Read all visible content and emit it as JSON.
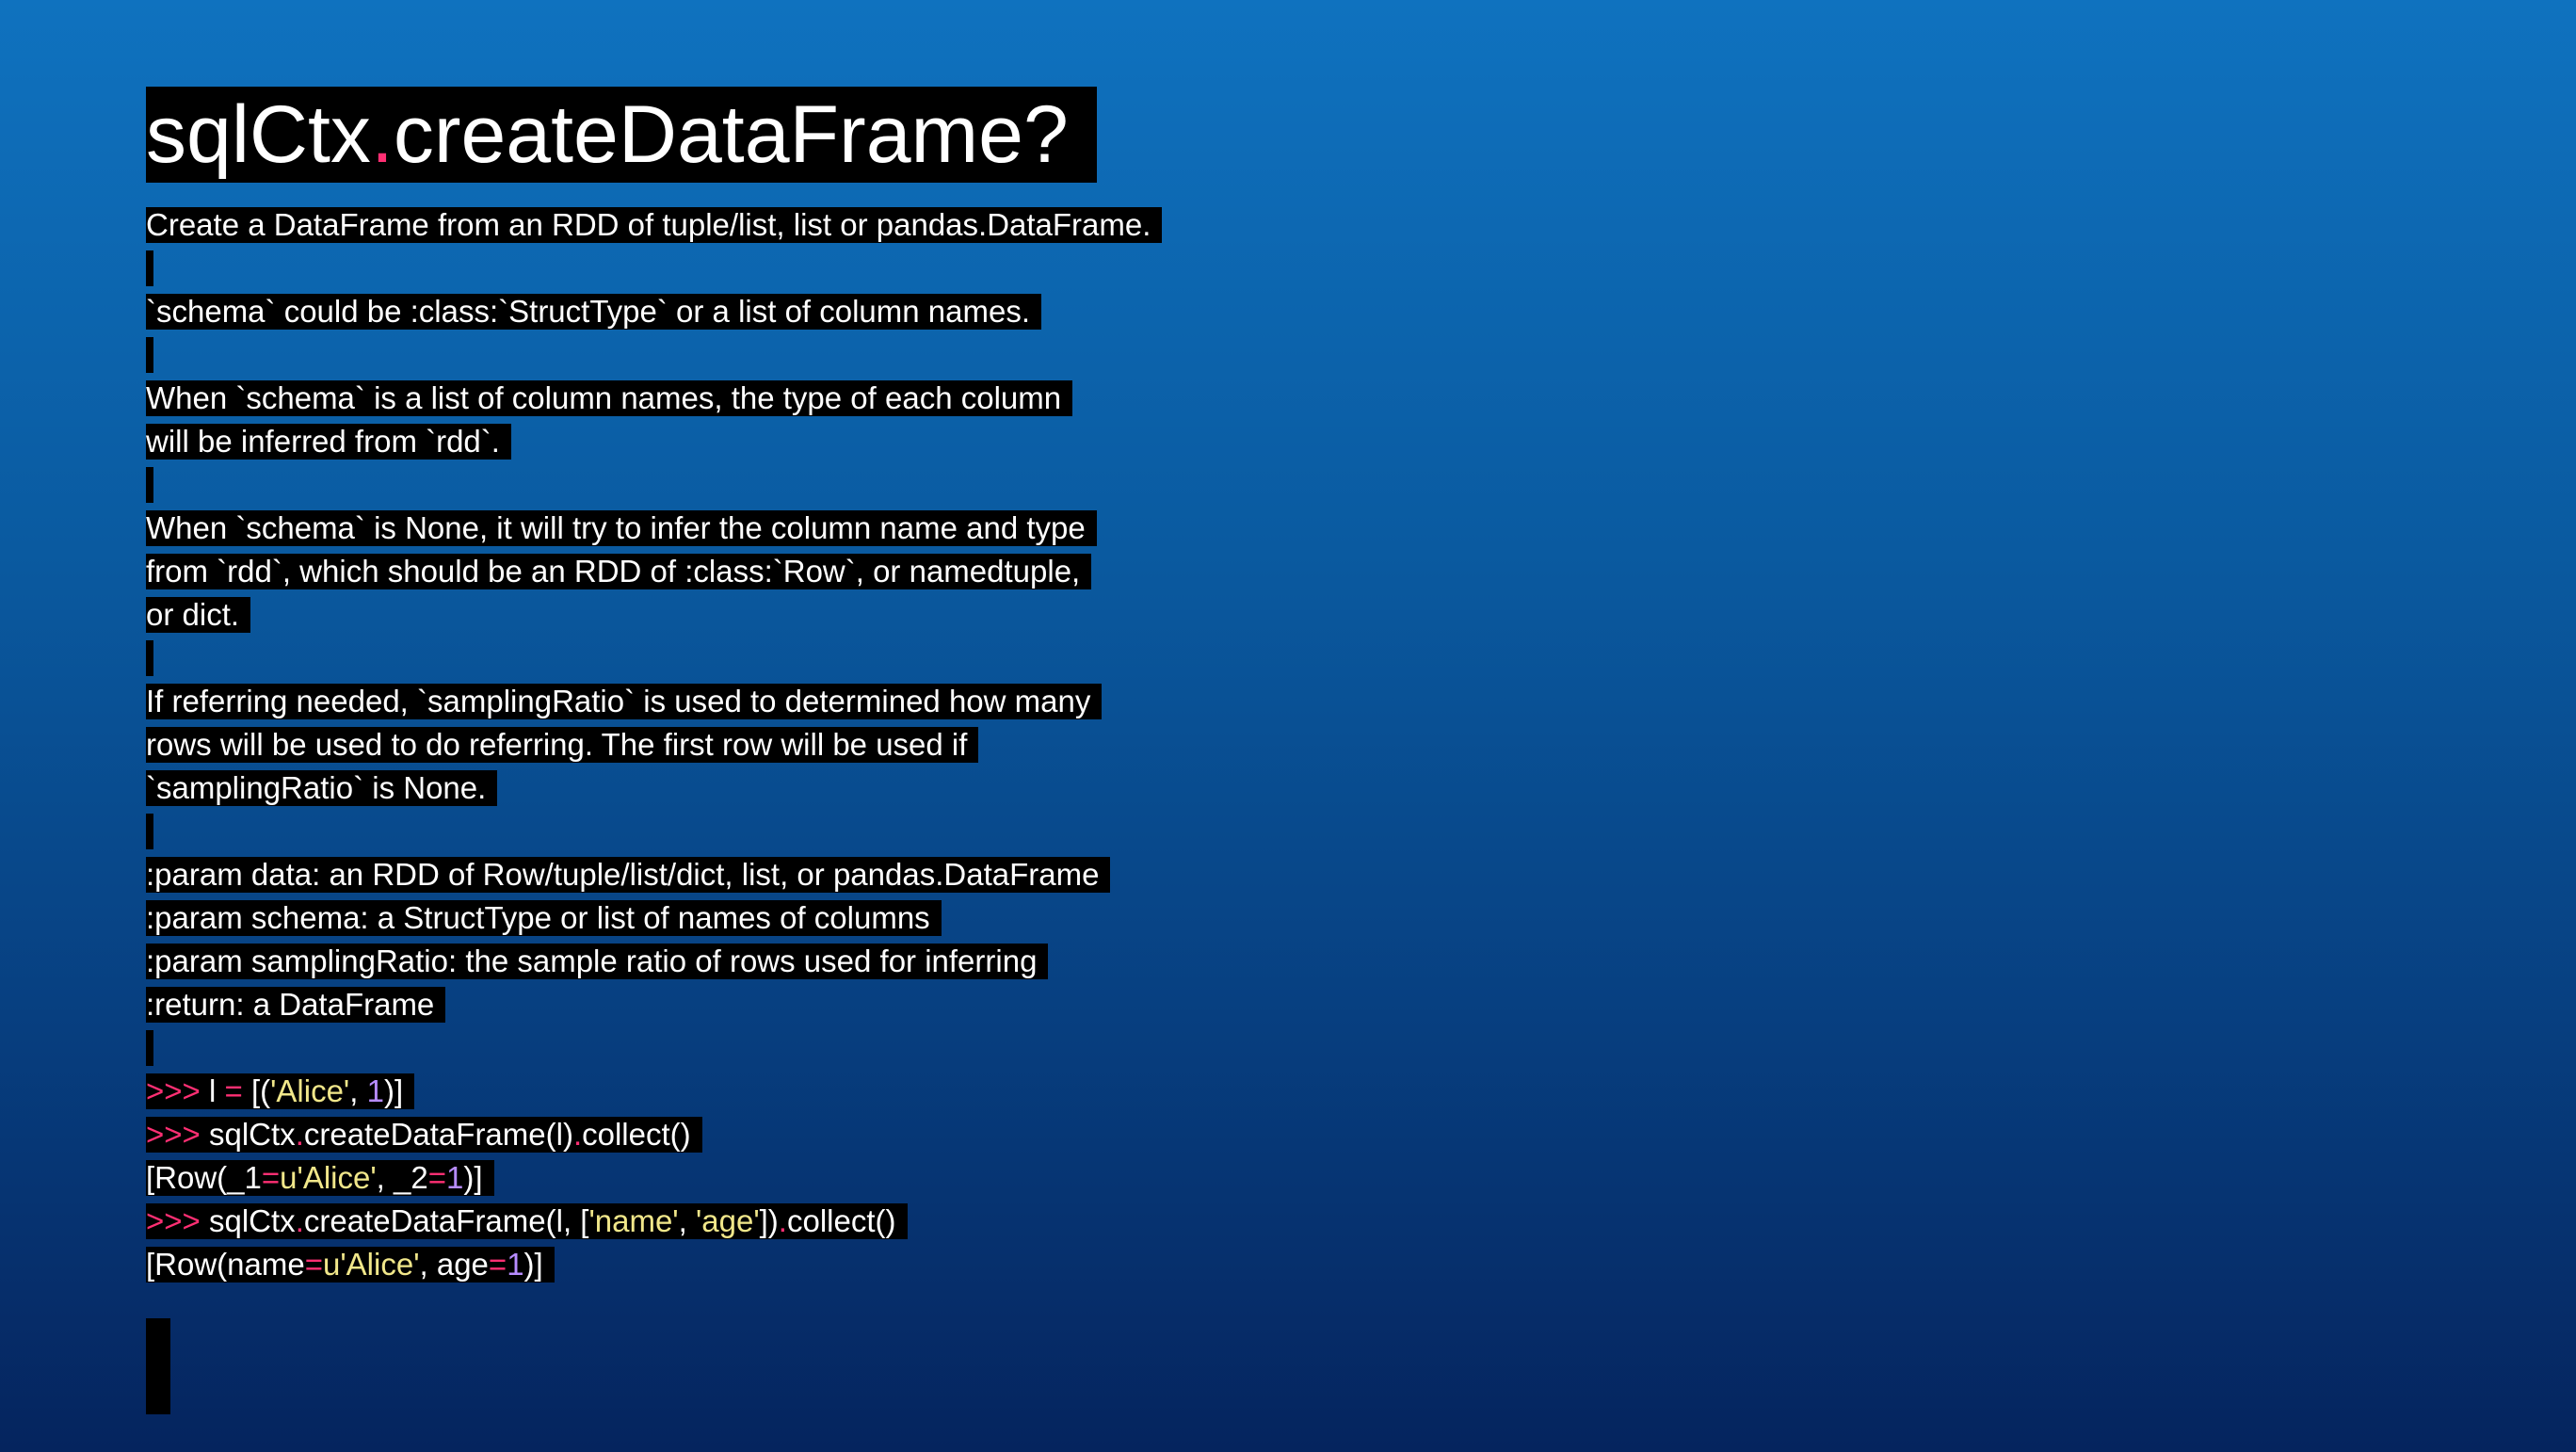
{
  "title": {
    "object": "sqlCtx",
    "dot": ".",
    "method": "createDataFrame?"
  },
  "doc_lines": [
    "Create a DataFrame from an RDD of tuple/list, list or pandas.DataFrame.",
    "",
    "`schema` could be :class:`StructType` or a list of column names.",
    "",
    "When `schema` is a list of column names, the type of each column",
    "will be inferred from `rdd`.",
    "",
    "When `schema` is None, it will try to infer the column name and type",
    "from `rdd`, which should be an RDD of :class:`Row`, or namedtuple,",
    "or dict.",
    "",
    "If referring needed, `samplingRatio` is used to determined how many",
    "rows will be used to do referring. The first row will be used if",
    "`samplingRatio` is None.",
    "",
    ":param data: an RDD of Row/tuple/list/dict, list, or pandas.DataFrame",
    ":param schema: a StructType or list of names of columns",
    ":param samplingRatio: the sample ratio of rows used for inferring",
    ":return: a DataFrame",
    ""
  ],
  "examples": {
    "ex1": {
      "prompt": ">>>",
      "var": " l ",
      "eq": "=",
      "open": " [(",
      "str": "'Alice'",
      "comma": ", ",
      "num": "1",
      "close": ")]"
    },
    "ex2": {
      "prompt": ">>>",
      "obj": " sqlCtx",
      "dot1": ".",
      "method": "createDataFrame(l)",
      "dot2": ".",
      "call": "collect()"
    },
    "out1": {
      "a": "[Row(_1",
      "eq1": "=",
      "s": "u'Alice'",
      "b": ", _2",
      "eq2": "=",
      "n": "1",
      "c": ")]"
    },
    "ex3": {
      "prompt": ">>>",
      "obj": " sqlCtx",
      "dot1": ".",
      "method": "createDataFrame(l, [",
      "s1": "'name'",
      "comma": ", ",
      "s2": "'age'",
      "close": "])",
      "dot2": ".",
      "call": "collect()"
    },
    "out2": {
      "a": "[Row(name",
      "eq1": "=",
      "s": "u'Alice'",
      "b": ", age",
      "eq2": "=",
      "n": "1",
      "c": ")]"
    }
  },
  "colors": {
    "background_top": "#0f72bf",
    "background_bottom": "#05245e",
    "highlight": "#000000",
    "accent_red": "#ff2f73",
    "string_yellow": "#f1e78a",
    "number_purple": "#b78cff"
  }
}
